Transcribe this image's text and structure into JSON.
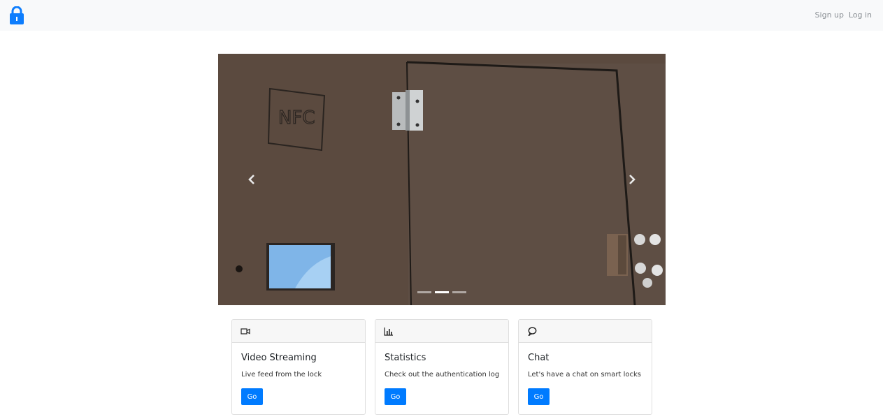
{
  "navbar": {
    "brand_icon": "lock-icon",
    "brand_color": "#0d7dfd",
    "links": [
      {
        "label": "Sign up"
      },
      {
        "label": "Log in"
      }
    ]
  },
  "carousel": {
    "slide_count": 3,
    "active_slide": 2,
    "photo_text": "NFC",
    "prev_icon": "chevron-left-icon",
    "next_icon": "chevron-right-icon"
  },
  "cards": [
    {
      "icon": "video-camera-icon",
      "title": "Video Streaming",
      "text": "Live feed from the lock",
      "button": "Go"
    },
    {
      "icon": "bar-chart-icon",
      "title": "Statistics",
      "text": "Check out the authentication log",
      "button": "Go"
    },
    {
      "icon": "chat-bubble-icon",
      "title": "Chat",
      "text": "Let's have a chat on smart locks",
      "button": "Go"
    }
  ],
  "colors": {
    "primary": "#007bff",
    "navbar_bg": "#f8f9fa",
    "photo_bg": "#5b4a3f"
  }
}
